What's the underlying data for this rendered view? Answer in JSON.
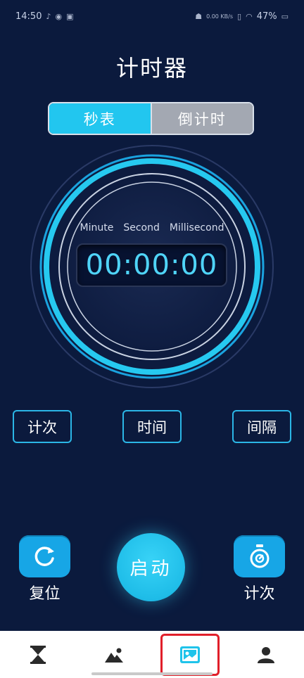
{
  "status_bar": {
    "time": "14:50",
    "battery": "47%",
    "net_speed": "0.00 KB/s",
    "left_icons": [
      "tiktok-icon",
      "weibo-icon",
      "app-icon"
    ],
    "right_icons": [
      "android-icon",
      "vibrate-icon",
      "wifi-icon",
      "battery-icon"
    ]
  },
  "header": {
    "title": "计时器"
  },
  "tabs": [
    {
      "label": "秒表",
      "active": true
    },
    {
      "label": "倒计时",
      "active": false
    }
  ],
  "timer": {
    "labels": [
      "Minute",
      "Second",
      "Millisecond"
    ],
    "value": "00:00:00"
  },
  "mode_buttons": [
    "计次",
    "时间",
    "间隔"
  ],
  "actions": {
    "reset_label": "复位",
    "start_label": "启动",
    "lap_label": "计次"
  },
  "bottom_nav": [
    {
      "icon": "hourglass-icon"
    },
    {
      "icon": "mountain-image-icon"
    },
    {
      "icon": "photo-card-icon",
      "highlighted": true
    },
    {
      "icon": "user-icon"
    }
  ],
  "colors": {
    "background": "#0b1a3d",
    "accent": "#22c6ef",
    "inactive_tab": "#a3a8b2",
    "highlight": "#e11f2a"
  }
}
